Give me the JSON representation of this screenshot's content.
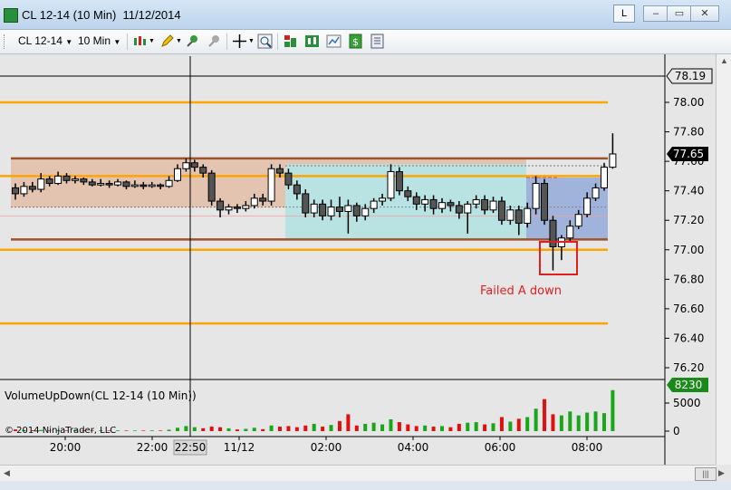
{
  "window": {
    "title": "CL 12-14 (10 Min)  11/12/2014",
    "link_label": "L",
    "buttons": [
      "–",
      "▭",
      "✕"
    ]
  },
  "toolbar": {
    "instrument": "CL 12-14",
    "interval": "10 Min"
  },
  "colors": {
    "bg": "#e6e6e6",
    "orange": "#ffa500",
    "brown": "#a0522d",
    "up_volume": "#1aa61a",
    "down_volume": "#e01010",
    "annotation": "#e02020"
  },
  "annotation": {
    "text": "Failed A down"
  },
  "indicator": {
    "label": "VolumeUpDown(CL 12-14 (10 Min))",
    "copyright": "© 2014 NinjaTrader, LLC",
    "last_volume": "8230"
  },
  "time_axis": {
    "labels": [
      "20:00",
      "22:00",
      "22:50",
      "11/12",
      "02:00",
      "04:00",
      "06:00",
      "08:00"
    ]
  },
  "chart_data": {
    "type": "candlestick",
    "price_axis": {
      "ticks": [
        "78.19",
        "78.00",
        "77.80",
        "77.60",
        "77.40",
        "77.20",
        "77.00",
        "76.80",
        "76.60",
        "76.40",
        "76.20"
      ],
      "last_price": "77.65",
      "ylim": [
        76.15,
        78.25
      ]
    },
    "volume_axis": {
      "ticks": [
        "5000",
        "0"
      ],
      "ylim": [
        0,
        9000
      ]
    },
    "levels": [
      {
        "price": 78.0,
        "color": "orange"
      },
      {
        "price": 77.5,
        "color": "orange"
      },
      {
        "price": 77.0,
        "color": "orange"
      },
      {
        "price": 76.5,
        "color": "orange"
      },
      {
        "price": 77.62,
        "color": "brown"
      },
      {
        "price": 77.07,
        "color": "brown"
      }
    ],
    "candles": [
      [
        77.42,
        77.38,
        77.45,
        77.34
      ],
      [
        77.38,
        77.43,
        77.46,
        77.36
      ],
      [
        77.43,
        77.41,
        77.46,
        77.39
      ],
      [
        77.41,
        77.48,
        77.52,
        77.39
      ],
      [
        77.48,
        77.45,
        77.5,
        77.43
      ],
      [
        77.45,
        77.5,
        77.53,
        77.44
      ],
      [
        77.5,
        77.47,
        77.52,
        77.45
      ],
      [
        77.47,
        77.48,
        77.5,
        77.45
      ],
      [
        77.48,
        77.46,
        77.49,
        77.44
      ],
      [
        77.46,
        77.44,
        77.48,
        77.43
      ],
      [
        77.44,
        77.45,
        77.48,
        77.43
      ],
      [
        77.45,
        77.44,
        77.47,
        77.42
      ],
      [
        77.44,
        77.46,
        77.48,
        77.43
      ],
      [
        77.46,
        77.43,
        77.47,
        77.41
      ],
      [
        77.43,
        77.44,
        77.47,
        77.42
      ],
      [
        77.44,
        77.43,
        77.46,
        77.41
      ],
      [
        77.43,
        77.44,
        77.46,
        77.42
      ],
      [
        77.44,
        77.43,
        77.45,
        77.41
      ],
      [
        77.43,
        77.47,
        77.5,
        77.42
      ],
      [
        77.47,
        77.55,
        77.58,
        77.46
      ],
      [
        77.55,
        77.59,
        77.62,
        77.53
      ],
      [
        77.59,
        77.56,
        77.61,
        77.53
      ],
      [
        77.56,
        77.52,
        77.58,
        77.49
      ],
      [
        77.52,
        77.33,
        77.54,
        77.3
      ],
      [
        77.33,
        77.27,
        77.35,
        77.22
      ],
      [
        77.27,
        77.29,
        77.31,
        77.24
      ],
      [
        77.29,
        77.28,
        77.31,
        77.25
      ],
      [
        77.28,
        77.3,
        77.33,
        77.26
      ],
      [
        77.3,
        77.35,
        77.38,
        77.28
      ],
      [
        77.35,
        77.33,
        77.38,
        77.3
      ],
      [
        77.33,
        77.55,
        77.58,
        77.3
      ],
      [
        77.55,
        77.52,
        77.58,
        77.49
      ],
      [
        77.52,
        77.44,
        77.55,
        77.41
      ],
      [
        77.44,
        77.38,
        77.47,
        77.34
      ],
      [
        77.38,
        77.25,
        77.41,
        77.22
      ],
      [
        77.25,
        77.31,
        77.34,
        77.22
      ],
      [
        77.31,
        77.23,
        77.34,
        77.2
      ],
      [
        77.23,
        77.29,
        77.34,
        77.2
      ],
      [
        77.29,
        77.26,
        77.36,
        77.22
      ],
      [
        77.26,
        77.3,
        77.34,
        77.11
      ],
      [
        77.3,
        77.23,
        77.32,
        77.19
      ],
      [
        77.23,
        77.28,
        77.31,
        77.2
      ],
      [
        77.28,
        77.33,
        77.35,
        77.25
      ],
      [
        77.33,
        77.35,
        77.38,
        77.3
      ],
      [
        77.35,
        77.53,
        77.58,
        77.33
      ],
      [
        77.53,
        77.4,
        77.56,
        77.37
      ],
      [
        77.4,
        77.36,
        77.43,
        77.33
      ],
      [
        77.36,
        77.31,
        77.39,
        77.27
      ],
      [
        77.31,
        77.34,
        77.37,
        77.26
      ],
      [
        77.34,
        77.28,
        77.37,
        77.24
      ],
      [
        77.28,
        77.32,
        77.35,
        77.25
      ],
      [
        77.32,
        77.3,
        77.34,
        77.26
      ],
      [
        77.3,
        77.25,
        77.33,
        77.21
      ],
      [
        77.25,
        77.31,
        77.33,
        77.11
      ],
      [
        77.31,
        77.34,
        77.37,
        77.28
      ],
      [
        77.34,
        77.27,
        77.37,
        77.24
      ],
      [
        77.27,
        77.33,
        77.36,
        77.25
      ],
      [
        77.33,
        77.2,
        77.36,
        77.17
      ],
      [
        77.2,
        77.27,
        77.3,
        77.17
      ],
      [
        77.27,
        77.18,
        77.3,
        77.1
      ],
      [
        77.18,
        77.28,
        77.32,
        77.15
      ],
      [
        77.28,
        77.45,
        77.5,
        77.24
      ],
      [
        77.45,
        77.2,
        77.48,
        77.17
      ],
      [
        77.2,
        77.02,
        77.23,
        76.86
      ],
      [
        77.02,
        77.08,
        77.1,
        76.93
      ],
      [
        77.08,
        77.16,
        77.2,
        77.05
      ],
      [
        77.16,
        77.24,
        77.27,
        77.14
      ],
      [
        77.24,
        77.35,
        77.39,
        77.22
      ],
      [
        77.35,
        77.42,
        77.45,
        77.33
      ],
      [
        77.42,
        77.56,
        77.59,
        77.4
      ],
      [
        77.56,
        77.65,
        77.79,
        77.55
      ]
    ],
    "volumes": [
      [
        300,
        "down"
      ],
      [
        200,
        "up"
      ],
      [
        150,
        "down"
      ],
      [
        200,
        "up"
      ],
      [
        100,
        "down"
      ],
      [
        150,
        "up"
      ],
      [
        100,
        "down"
      ],
      [
        150,
        "up"
      ],
      [
        120,
        "down"
      ],
      [
        100,
        "down"
      ],
      [
        130,
        "up"
      ],
      [
        100,
        "down"
      ],
      [
        120,
        "up"
      ],
      [
        100,
        "down"
      ],
      [
        110,
        "up"
      ],
      [
        100,
        "down"
      ],
      [
        120,
        "up"
      ],
      [
        100,
        "down"
      ],
      [
        250,
        "up"
      ],
      [
        600,
        "up"
      ],
      [
        900,
        "up"
      ],
      [
        700,
        "up"
      ],
      [
        500,
        "down"
      ],
      [
        800,
        "down"
      ],
      [
        700,
        "down"
      ],
      [
        500,
        "up"
      ],
      [
        300,
        "down"
      ],
      [
        400,
        "up"
      ],
      [
        600,
        "up"
      ],
      [
        350,
        "down"
      ],
      [
        1000,
        "up"
      ],
      [
        800,
        "down"
      ],
      [
        900,
        "down"
      ],
      [
        700,
        "down"
      ],
      [
        1000,
        "down"
      ],
      [
        1300,
        "up"
      ],
      [
        800,
        "down"
      ],
      [
        1100,
        "up"
      ],
      [
        1800,
        "down"
      ],
      [
        3000,
        "down"
      ],
      [
        1000,
        "down"
      ],
      [
        1300,
        "up"
      ],
      [
        1500,
        "up"
      ],
      [
        1200,
        "up"
      ],
      [
        2100,
        "up"
      ],
      [
        1600,
        "down"
      ],
      [
        1200,
        "down"
      ],
      [
        900,
        "down"
      ],
      [
        1000,
        "up"
      ],
      [
        800,
        "down"
      ],
      [
        900,
        "up"
      ],
      [
        700,
        "down"
      ],
      [
        1300,
        "down"
      ],
      [
        1500,
        "up"
      ],
      [
        1600,
        "up"
      ],
      [
        1200,
        "down"
      ],
      [
        1400,
        "up"
      ],
      [
        2500,
        "down"
      ],
      [
        1700,
        "up"
      ],
      [
        2200,
        "down"
      ],
      [
        2500,
        "up"
      ],
      [
        4000,
        "up"
      ],
      [
        5700,
        "down"
      ],
      [
        3000,
        "down"
      ],
      [
        2800,
        "up"
      ],
      [
        3500,
        "up"
      ],
      [
        2800,
        "up"
      ],
      [
        3300,
        "up"
      ],
      [
        3500,
        "up"
      ],
      [
        3200,
        "up"
      ],
      [
        7300,
        "up"
      ]
    ]
  }
}
